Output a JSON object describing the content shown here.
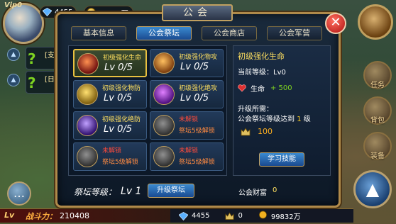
{
  "hud": {
    "vip": "Vip0",
    "gems": "4455",
    "gold": "99832万",
    "quests": [
      {
        "tag": "[支"
      },
      {
        "tag": "[日"
      }
    ],
    "chat_icon": "chat-bubble-icon"
  },
  "power": {
    "level": "Lv",
    "label": "战斗力：",
    "value": "210408"
  },
  "bottom": {
    "gems": "4455",
    "honor": "0",
    "gold": "99832万"
  },
  "right": {
    "quest_btn": "任务",
    "bag_btn": "背包",
    "equip_btn": "装备",
    "nav_icon": "navigation-arrow-icon"
  },
  "dialog": {
    "title": "公会",
    "close": "✕",
    "tabs": [
      {
        "label": "基本信息"
      },
      {
        "label": "公会祭坛"
      },
      {
        "label": "公会商店"
      },
      {
        "label": "公会军营"
      }
    ],
    "skills": [
      {
        "name": "初级强化生命",
        "level": "Lv 0/5",
        "locked": false,
        "selected": true,
        "color": "#c04020"
      },
      {
        "name": "初级强化物攻",
        "level": "Lv 0/5",
        "locked": false,
        "selected": false,
        "color": "#d07020"
      },
      {
        "name": "初级强化物防",
        "level": "Lv 0/5",
        "locked": false,
        "selected": false,
        "color": "#d09020"
      },
      {
        "name": "初级强化绝攻",
        "level": "Lv 0/5",
        "locked": false,
        "selected": false,
        "color": "#a040d0"
      },
      {
        "name": "初级强化绝防",
        "level": "Lv 0/5",
        "locked": false,
        "selected": false,
        "color": "#7040c0"
      },
      {
        "name": "未解锁",
        "sub": "祭坛5级解锁",
        "locked": true,
        "color": "#606060"
      },
      {
        "name": "未解锁",
        "sub": "祭坛5级解锁",
        "locked": true,
        "color": "#606060"
      },
      {
        "name": "未解锁",
        "sub": "祭坛5级解锁",
        "locked": true,
        "color": "#606060"
      }
    ],
    "detail": {
      "title": "初级强化生命",
      "current_level": "当前等级：Lv0",
      "stat_name": "生命",
      "stat_value": "+ 500",
      "req_header": "升级所需：",
      "req_text_pre": "公会祭坛等级达到",
      "req_level": "1",
      "req_text_post": "级",
      "cost": "100",
      "learn_button": "学习技能"
    },
    "altar_label": "祭坛等级：",
    "altar_level": "Lv 1",
    "upgrade_button": "升级祭坛",
    "wealth_label": "公会财富",
    "wealth_value": "0"
  }
}
